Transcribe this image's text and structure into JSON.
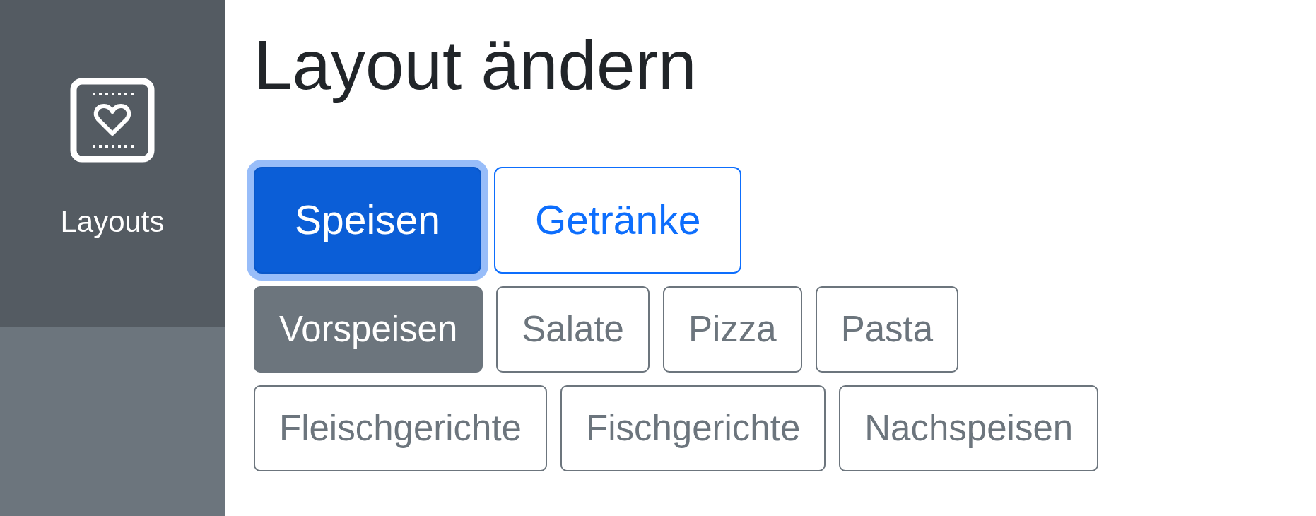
{
  "sidebar": {
    "items": [
      {
        "label": "Layouts",
        "selected": true
      }
    ]
  },
  "title": "Layout ändern",
  "menu_tabs": [
    {
      "label": "Speisen",
      "selected": true
    },
    {
      "label": "Getränke",
      "selected": false
    }
  ],
  "categories": [
    {
      "label": "Vorspeisen",
      "selected": true
    },
    {
      "label": "Salate",
      "selected": false
    },
    {
      "label": "Pizza",
      "selected": false
    },
    {
      "label": "Pasta",
      "selected": false
    },
    {
      "label": "Fleischgerichte",
      "selected": false
    },
    {
      "label": "Fischgerichte",
      "selected": false
    },
    {
      "label": "Nachspeisen",
      "selected": false
    }
  ]
}
